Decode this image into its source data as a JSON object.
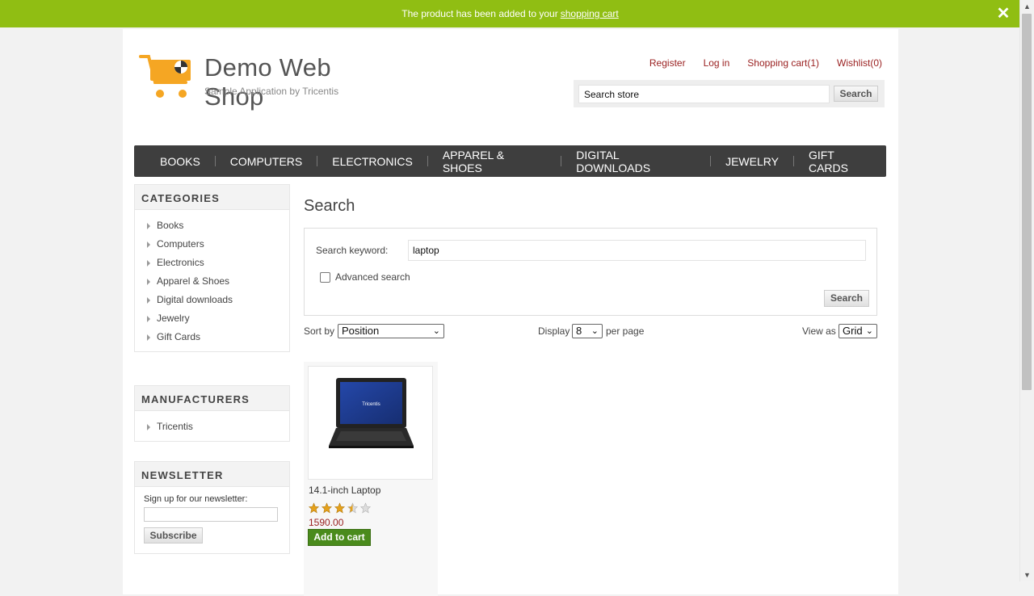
{
  "notification": {
    "message": "The product has been added to your",
    "link_text": "shopping cart"
  },
  "logo": {
    "title": "Demo Web Shop",
    "tagline": "Sample Application by Tricentis"
  },
  "header_links": {
    "register": "Register",
    "login": "Log in",
    "cart": "Shopping cart(1)",
    "wishlist": "Wishlist(0)"
  },
  "header_search": {
    "value": "Search store",
    "button": "Search"
  },
  "top_menu": [
    "BOOKS",
    "COMPUTERS",
    "ELECTRONICS",
    "APPAREL & SHOES",
    "DIGITAL DOWNLOADS",
    "JEWELRY",
    "GIFT CARDS"
  ],
  "categories": {
    "title": "CATEGORIES",
    "items": [
      "Books",
      "Computers",
      "Electronics",
      "Apparel & Shoes",
      "Digital downloads",
      "Jewelry",
      "Gift Cards"
    ]
  },
  "manufacturers": {
    "title": "MANUFACTURERS",
    "items": [
      "Tricentis"
    ]
  },
  "newsletter": {
    "title": "NEWSLETTER",
    "label": "Sign up for our newsletter:",
    "button": "Subscribe"
  },
  "search_page": {
    "title": "Search",
    "keyword_label": "Search keyword:",
    "keyword_value": "laptop",
    "advanced_label": "Advanced search",
    "button": "Search"
  },
  "controls": {
    "sort_label": "Sort by",
    "sort_value": "Position",
    "display_label": "Display",
    "display_value": "8",
    "per_page": "per page",
    "view_label": "View as",
    "view_value": "Grid"
  },
  "product": {
    "name": "14.1-inch Laptop",
    "rating_stars": 3.5,
    "rating_max": 5,
    "price": "1590.00",
    "add_button": "Add to cart",
    "screen_text": "Tricentis"
  },
  "colors": {
    "notification_bg": "#90be13",
    "link_red": "#991e1e",
    "add_button_green": "#4a8b1c",
    "star_gold": "#e5a11b"
  }
}
